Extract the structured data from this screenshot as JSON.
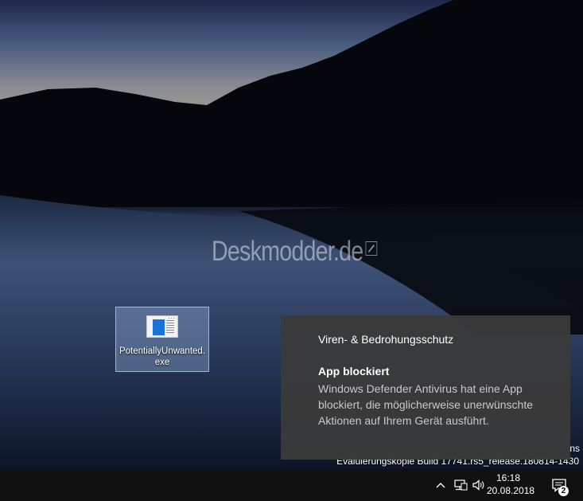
{
  "desktop": {
    "watermark": "Deskmodder.de",
    "icons": [
      {
        "label": "PotentiallyUnwanted.\nexe",
        "icon": "application-window-icon"
      }
    ],
    "build_text": "Evaluierungskopie Build 17741.rs5_release.180814-1430",
    "edge_text": "ns"
  },
  "toast": {
    "app_name": "Viren- & Bedrohungsschutz",
    "title": "App blockiert",
    "body": "Windows Defender Antivirus hat eine App blockiert, die möglicherweise unerwünschte Aktionen auf Ihrem Gerät ausführt."
  },
  "taskbar": {
    "tray": [
      "chevron-up-icon",
      "network-icon",
      "volume-icon"
    ],
    "time": "16:18",
    "date": "20.08.2018",
    "notifications_count": "2"
  },
  "colors": {
    "toast_bg": "#3a3a3a",
    "taskbar_bg": "#101010",
    "icon_blue": "#1a73d9"
  }
}
